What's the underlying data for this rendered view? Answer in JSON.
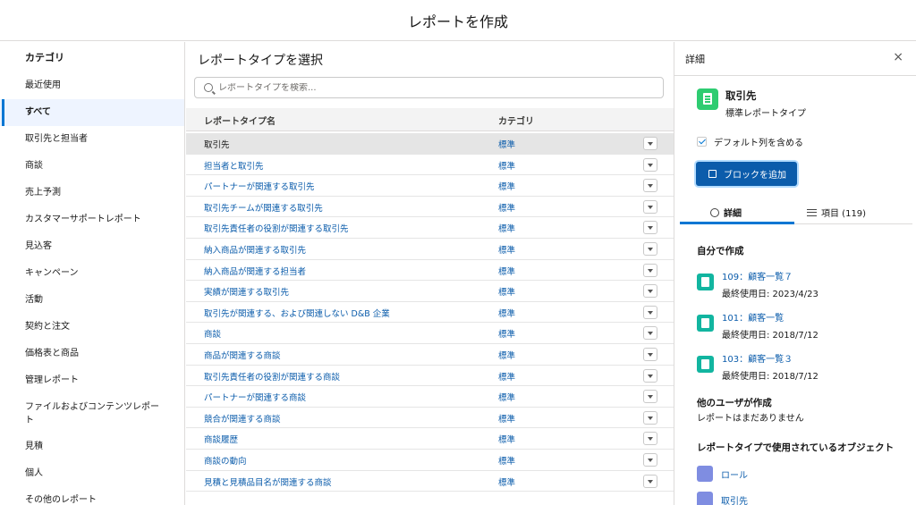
{
  "title": "レポートを作成",
  "categories": {
    "heading": "カテゴリ",
    "items": [
      "最近使用",
      "すべて",
      "取引先と担当者",
      "商談",
      "売上予測",
      "カスタマーサポートレポート",
      "見込客",
      "キャンペーン",
      "活動",
      "契約と注文",
      "価格表と商品",
      "管理レポート",
      "ファイルおよびコンテンツレポート",
      "見積",
      "個人",
      "その他のレポート"
    ],
    "active_index": 1
  },
  "main": {
    "heading": "レポートタイプを選択",
    "search_placeholder": "レポートタイプを検索...",
    "columns": [
      "レポートタイプ名",
      "カテゴリ"
    ],
    "rows": [
      {
        "name": "取引先",
        "category": "標準"
      },
      {
        "name": "担当者と取引先",
        "category": "標準"
      },
      {
        "name": "パートナーが関連する取引先",
        "category": "標準"
      },
      {
        "name": "取引先チームが関連する取引先",
        "category": "標準"
      },
      {
        "name": "取引先責任者の役割が関連する取引先",
        "category": "標準"
      },
      {
        "name": "納入商品が関連する取引先",
        "category": "標準"
      },
      {
        "name": "納入商品が関連する担当者",
        "category": "標準"
      },
      {
        "name": "実績が関連する取引先",
        "category": "標準"
      },
      {
        "name": "取引先が関連する、および関連しない D&B 企業",
        "category": "標準"
      },
      {
        "name": "商談",
        "category": "標準"
      },
      {
        "name": "商品が関連する商談",
        "category": "標準"
      },
      {
        "name": "取引先責任者の役割が関連する商談",
        "category": "標準"
      },
      {
        "name": "パートナーが関連する商談",
        "category": "標準"
      },
      {
        "name": "競合が関連する商談",
        "category": "標準"
      },
      {
        "name": "商談履歴",
        "category": "標準"
      },
      {
        "name": "商談の動向",
        "category": "標準"
      },
      {
        "name": "見積と見積品目名が関連する商談",
        "category": "標準"
      }
    ],
    "selected_index": 0
  },
  "details": {
    "heading": "詳細",
    "close_label": "×",
    "object_name": "取引先",
    "object_type": "標準レポートタイプ",
    "include_default_columns": "デフォルト列を含める",
    "add_block_button": "ブロックを追加",
    "tabs": [
      "詳細",
      "項目 (119)"
    ],
    "created_by_me_heading": "自分で作成",
    "reports": [
      {
        "name": "109：顧客一覧７",
        "last_used": "最終使用日: 2023/4/23"
      },
      {
        "name": "101：顧客一覧",
        "last_used": "最終使用日: 2018/7/12"
      },
      {
        "name": "103：顧客一覧３",
        "last_used": "最終使用日: 2018/7/12"
      }
    ],
    "others_heading": "他のユーザが作成",
    "others_empty": "レポートはまだありません",
    "objects_heading": "レポートタイプで使用されているオブジェクト",
    "objects": [
      {
        "name": "ロール",
        "color": "#7f8de1"
      },
      {
        "name": "取引先",
        "color": "#7f8de1"
      }
    ]
  },
  "colors": {
    "accent": "#0176d3",
    "button": "#0b5cab",
    "object_icon": "#2ecc71",
    "report_icon": "#12b5a0"
  }
}
